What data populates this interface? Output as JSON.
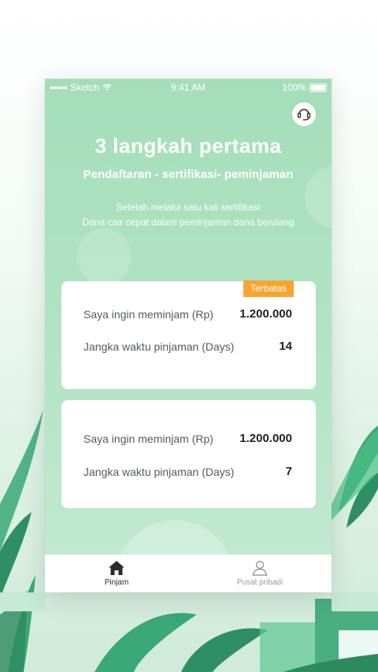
{
  "status_bar": {
    "carrier": "Sketch",
    "time": "9:41 AM",
    "battery": "100%"
  },
  "header": {
    "title": "3 langkah pertama",
    "subtitle": "Pendaftaran - sertifikasi- peminjaman",
    "description_line1": "Setelah melalui satu kali sertifikasi",
    "description_line2": "Dana cair cepat dalam peminjaman dana berulang"
  },
  "loan_cards": [
    {
      "badge": "Terbatas",
      "amount_label": "Saya ingin meminjam (Rp)",
      "amount_value": "1.200.000",
      "term_label": "Jangka waktu pinjaman (Days)",
      "term_value": "14"
    },
    {
      "amount_label": "Saya ingin meminjam (Rp)",
      "amount_value": "1.200.000",
      "term_label": "Jangka waktu pinjaman (Days)",
      "term_value": "7"
    }
  ],
  "tabbar": {
    "tabs": [
      {
        "label": "Pinjam",
        "icon": "home-icon",
        "active": true
      },
      {
        "label": "Pusat pribadi",
        "icon": "user-icon",
        "active": false
      }
    ]
  },
  "colors": {
    "accent_green": "#a4deb9",
    "badge_orange": "#f7a530",
    "active_tab": "#2b2b2b",
    "inactive_tab": "#9a9a9a"
  }
}
